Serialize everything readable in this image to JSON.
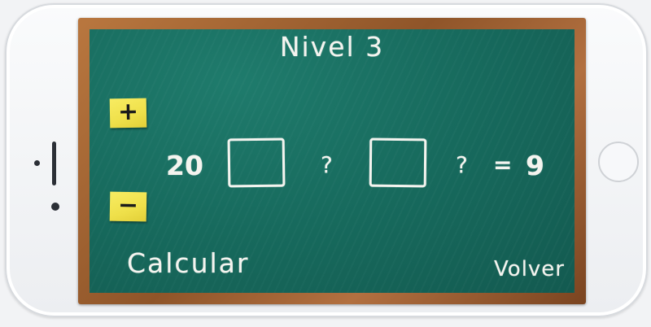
{
  "title": "Nivel 3",
  "controls": {
    "plus_label": "+",
    "minus_label": "−"
  },
  "equation": {
    "left_value": "20",
    "operator_1": "?",
    "operator_2": "?",
    "equals": "=",
    "result": "9"
  },
  "actions": {
    "calculate_label": "Calcular",
    "back_label": "Volver"
  },
  "icons": {
    "phone_home": "home-button-icon"
  },
  "colors": {
    "chalkboard": "#176a5d",
    "frame": "#9a5b2c",
    "sticky_note": "#f2e44e",
    "chalk": "#f4f4ef"
  }
}
